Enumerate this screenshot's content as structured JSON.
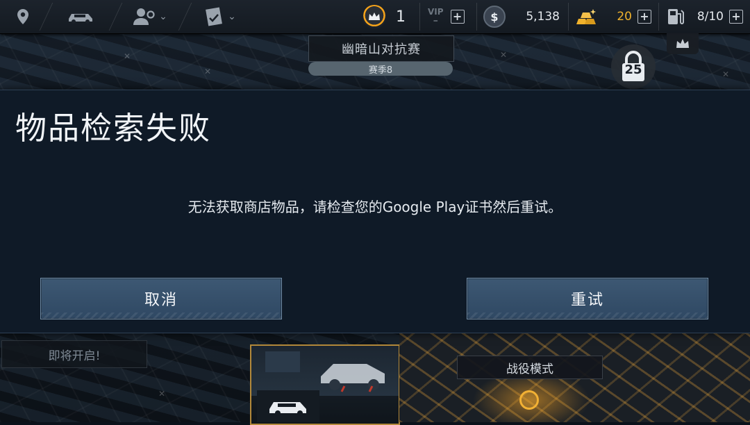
{
  "hud": {
    "nav": [
      {
        "name": "map-pin-icon"
      },
      {
        "name": "car-icon"
      },
      {
        "name": "profile-settings-icon"
      },
      {
        "name": "dropdown-chevron-icon"
      },
      {
        "name": "license-check-icon"
      },
      {
        "name": "dropdown-chevron-icon"
      }
    ],
    "level": "1",
    "vip_label": "VIP",
    "vip_sub": "–",
    "cash": "5,138",
    "gold": "20",
    "fuel": "8/10"
  },
  "event": {
    "title": "幽暗山对抗赛",
    "season": "赛季8",
    "lock_level": "25"
  },
  "dialog": {
    "title": "物品检索失败",
    "message": "无法获取商店物品，请检查您的Google Play证书然后重试。",
    "cancel_label": "取消",
    "retry_label": "重试"
  },
  "bottom": {
    "coming_soon": "即将开启!",
    "campaign_label": "战役模式"
  },
  "colors": {
    "accent_gold": "#f0b22c",
    "button_blue": "#3d5873",
    "modal_bg": "#0f1a27"
  }
}
